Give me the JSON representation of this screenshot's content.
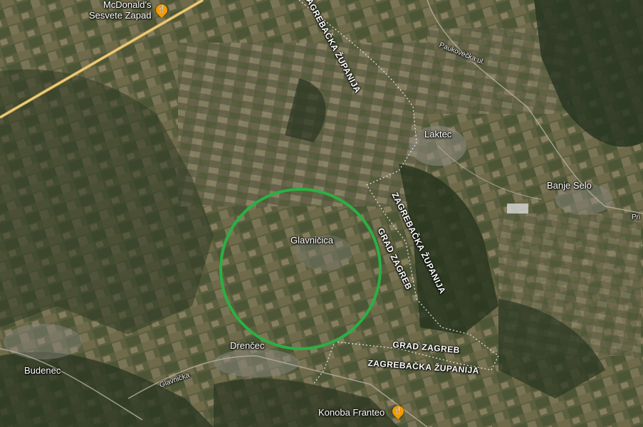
{
  "map": {
    "type": "satellite",
    "highlight_color": "#2bb044",
    "places": {
      "glavnicica": "Glavničica",
      "laktec": "Laktec",
      "banje_selo": "Banje Selo",
      "drencec": "Drenčec",
      "budenec": "Budenec",
      "pri": "Pri"
    },
    "pois": {
      "mcdonalds_line1": "McDonald's",
      "mcdonalds_line2": "Sesvete Zapad",
      "konoba": "Konoba Franteo"
    },
    "roads": {
      "glavnicka": "Glavnička",
      "paukovecka": "Paukovečka ul."
    },
    "boundaries": {
      "zagrebacka_top": "ZAGREBAČKA ŽUPANIJA",
      "grad_zagreb_vertical": "GRAD ZAGREB",
      "zagrebacka_vertical": "ZAGREBAČKA ŽUPANIJA",
      "grad_zagreb_bottom": "GRAD ZAGREB",
      "zagrebacka_bottom": "ZAGREBAČKA ŽUPANIJA"
    },
    "icons": {
      "restaurant": "fork-knife-icon"
    }
  }
}
